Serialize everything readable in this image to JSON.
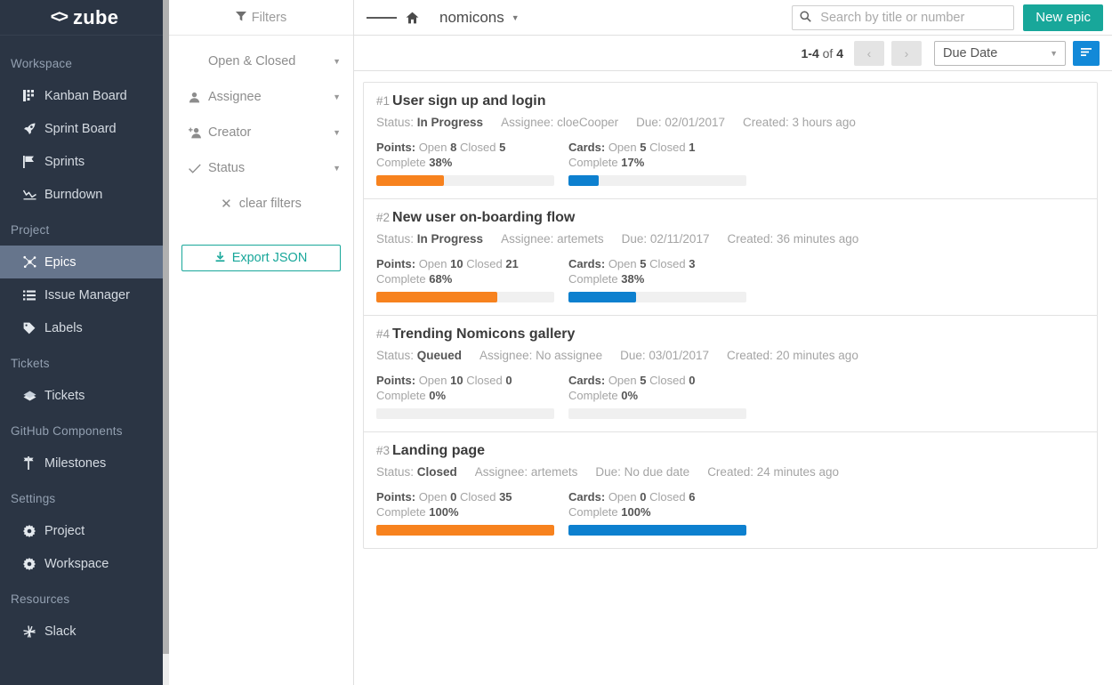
{
  "brand": {
    "name": "zube",
    "mark": "<>"
  },
  "sidebar": {
    "sections": [
      {
        "label": "Workspace",
        "items": [
          {
            "label": "Kanban Board",
            "icon": "kanban-icon",
            "active": false
          },
          {
            "label": "Sprint Board",
            "icon": "rocket-icon",
            "active": false
          },
          {
            "label": "Sprints",
            "icon": "flag-icon",
            "active": false
          },
          {
            "label": "Burndown",
            "icon": "chart-line-icon",
            "active": false
          }
        ]
      },
      {
        "label": "Project",
        "items": [
          {
            "label": "Epics",
            "icon": "epics-icon",
            "active": true
          },
          {
            "label": "Issue Manager",
            "icon": "list-icon",
            "active": false
          },
          {
            "label": "Labels",
            "icon": "tag-icon",
            "active": false
          }
        ]
      },
      {
        "label": "Tickets",
        "items": [
          {
            "label": "Tickets",
            "icon": "tickets-icon",
            "active": false
          }
        ]
      },
      {
        "label": "GitHub Components",
        "items": [
          {
            "label": "Milestones",
            "icon": "milestone-icon",
            "active": false
          }
        ]
      },
      {
        "label": "Settings",
        "items": [
          {
            "label": "Project",
            "icon": "gear-icon",
            "active": false
          },
          {
            "label": "Workspace",
            "icon": "gear-icon",
            "active": false
          }
        ]
      },
      {
        "label": "Resources",
        "items": [
          {
            "label": "Slack",
            "icon": "slack-icon",
            "active": false
          }
        ]
      }
    ]
  },
  "filters": {
    "title": "Filters",
    "rows": [
      {
        "label": "Open & Closed",
        "icon": "none"
      },
      {
        "label": "Assignee",
        "icon": "user-icon"
      },
      {
        "label": "Creator",
        "icon": "user-plus-icon"
      },
      {
        "label": "Status",
        "icon": "check-icon"
      }
    ],
    "clear_label": "clear filters",
    "export_label": "Export JSON"
  },
  "topbar": {
    "project": "nomicons",
    "search_placeholder": "Search by title or number",
    "search_value": "",
    "new_epic_label": "New epic"
  },
  "subbar": {
    "range": "1-4",
    "of_label": "of",
    "total": "4",
    "prev": "‹",
    "next": "›",
    "sort_field": "Due Date"
  },
  "epics": [
    {
      "number": "#1",
      "title": "User sign up and login",
      "status_label": "Status:",
      "status": "In Progress",
      "assignee_label": "Assignee:",
      "assignee": "cloeCooper",
      "due_label": "Due:",
      "due": "02/01/2017",
      "created_label": "Created:",
      "created": "3 hours ago",
      "points": {
        "key": "Points:",
        "open_label": "Open",
        "open": "8",
        "closed_label": "Closed",
        "closed": "5",
        "complete_label": "Complete",
        "complete": "38%",
        "percent": 38
      },
      "cards": {
        "key": "Cards:",
        "open_label": "Open",
        "open": "5",
        "closed_label": "Closed",
        "closed": "1",
        "complete_label": "Complete",
        "complete": "17%",
        "percent": 17
      }
    },
    {
      "number": "#2",
      "title": "New user on-boarding flow",
      "status_label": "Status:",
      "status": "In Progress",
      "assignee_label": "Assignee:",
      "assignee": "artemets",
      "due_label": "Due:",
      "due": "02/11/2017",
      "created_label": "Created:",
      "created": "36 minutes ago",
      "points": {
        "key": "Points:",
        "open_label": "Open",
        "open": "10",
        "closed_label": "Closed",
        "closed": "21",
        "complete_label": "Complete",
        "complete": "68%",
        "percent": 68
      },
      "cards": {
        "key": "Cards:",
        "open_label": "Open",
        "open": "5",
        "closed_label": "Closed",
        "closed": "3",
        "complete_label": "Complete",
        "complete": "38%",
        "percent": 38
      }
    },
    {
      "number": "#4",
      "title": "Trending Nomicons gallery",
      "status_label": "Status:",
      "status": "Queued",
      "assignee_label": "Assignee:",
      "assignee": "No assignee",
      "due_label": "Due:",
      "due": "03/01/2017",
      "created_label": "Created:",
      "created": "20 minutes ago",
      "points": {
        "key": "Points:",
        "open_label": "Open",
        "open": "10",
        "closed_label": "Closed",
        "closed": "0",
        "complete_label": "Complete",
        "complete": "0%",
        "percent": 0
      },
      "cards": {
        "key": "Cards:",
        "open_label": "Open",
        "open": "5",
        "closed_label": "Closed",
        "closed": "0",
        "complete_label": "Complete",
        "complete": "0%",
        "percent": 0
      }
    },
    {
      "number": "#3",
      "title": "Landing page",
      "status_label": "Status:",
      "status": "Closed",
      "assignee_label": "Assignee:",
      "assignee": "artemets",
      "due_label": "Due:",
      "due": "No due date",
      "created_label": "Created:",
      "created": "24 minutes ago",
      "points": {
        "key": "Points:",
        "open_label": "Open",
        "open": "0",
        "closed_label": "Closed",
        "closed": "35",
        "complete_label": "Complete",
        "complete": "100%",
        "percent": 100
      },
      "cards": {
        "key": "Cards:",
        "open_label": "Open",
        "open": "0",
        "closed_label": "Closed",
        "closed": "6",
        "complete_label": "Complete",
        "complete": "100%",
        "percent": 100
      }
    }
  ],
  "colors": {
    "sidebar_bg": "#2b3544",
    "sidebar_active": "#66758c",
    "accent_teal": "#18a79a",
    "points_bar": "#f7821e",
    "cards_bar": "#0d80cf",
    "sort_button": "#1289d8"
  }
}
